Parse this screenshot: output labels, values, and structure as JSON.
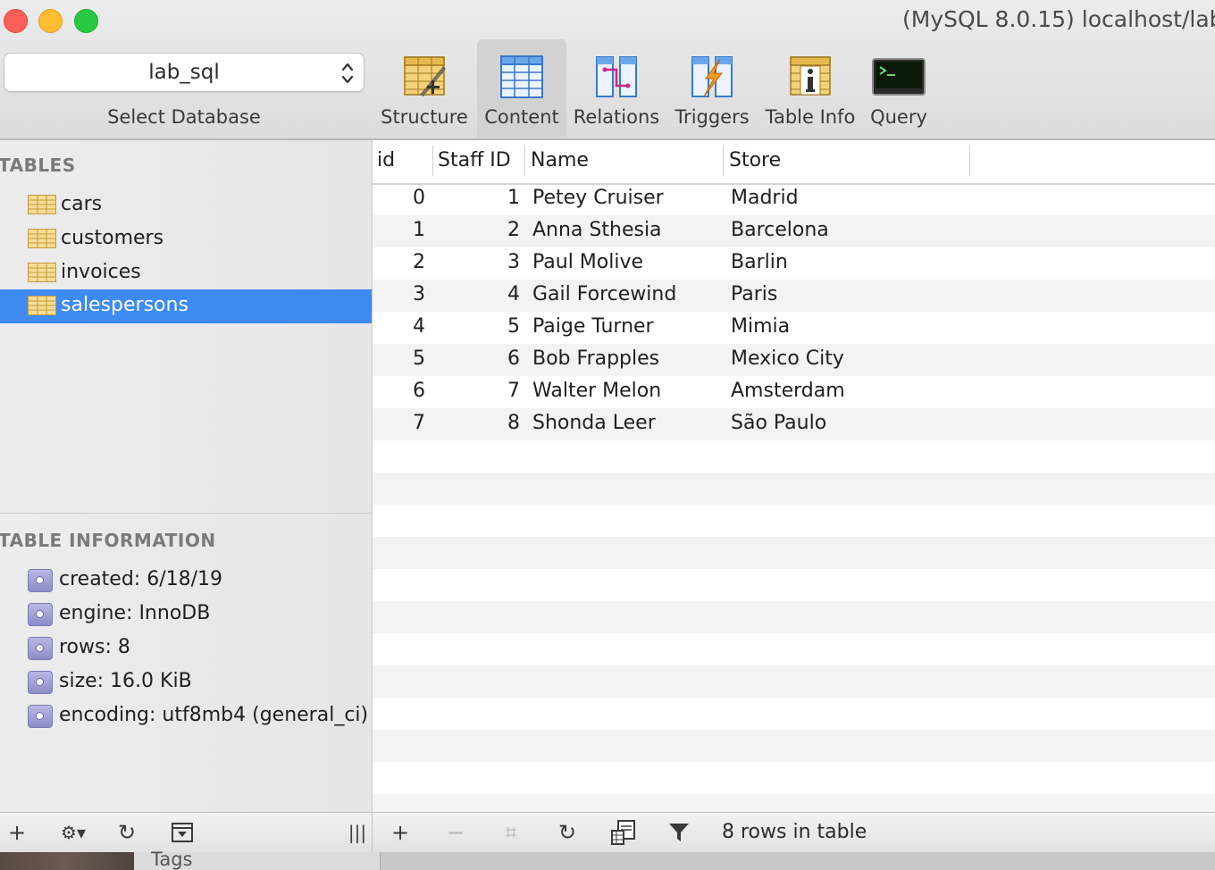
{
  "window": {
    "title": "(MySQL 8.0.15) localhost/lab"
  },
  "database_select": {
    "value": "lab_sql",
    "label": "Select Database"
  },
  "toolbar": {
    "items": [
      {
        "label": "Structure",
        "icon": "structure-icon"
      },
      {
        "label": "Content",
        "icon": "content-icon",
        "active": true
      },
      {
        "label": "Relations",
        "icon": "relations-icon"
      },
      {
        "label": "Triggers",
        "icon": "triggers-icon"
      },
      {
        "label": "Table Info",
        "icon": "table-info-icon"
      },
      {
        "label": "Query",
        "icon": "terminal-icon"
      }
    ]
  },
  "sidebar": {
    "tables_header": "TABLES",
    "tables": [
      {
        "name": "cars"
      },
      {
        "name": "customers"
      },
      {
        "name": "invoices"
      },
      {
        "name": "salespersons",
        "selected": true
      }
    ],
    "info_header": "TABLE INFORMATION",
    "info": [
      {
        "text": "created: 6/18/19"
      },
      {
        "text": "engine: InnoDB"
      },
      {
        "text": "rows: 8"
      },
      {
        "text": "size: 16.0 KiB"
      },
      {
        "text": "encoding: utf8mb4 (general_ci)"
      }
    ]
  },
  "table": {
    "columns": [
      "id",
      "Staff ID",
      "Name",
      "Store"
    ],
    "rows": [
      [
        "0",
        "1",
        "Petey Cruiser",
        "Madrid"
      ],
      [
        "1",
        "2",
        "Anna Sthesia",
        "Barcelona"
      ],
      [
        "2",
        "3",
        "Paul Molive",
        "Barlin"
      ],
      [
        "3",
        "4",
        "Gail Forcewind",
        "Paris"
      ],
      [
        "4",
        "5",
        "Paige Turner",
        "Mimia"
      ],
      [
        "5",
        "6",
        "Bob Frapples",
        "Mexico City"
      ],
      [
        "6",
        "7",
        "Walter Melon",
        "Amsterdam"
      ],
      [
        "7",
        "8",
        "Shonda Leer",
        "São Paulo"
      ]
    ]
  },
  "bottom_left": {
    "add": "+",
    "gear": "⚙▾",
    "refresh": "↻",
    "columns": "|||"
  },
  "bottom_right": {
    "add": "+",
    "remove": "−",
    "duplicate": "⌗",
    "refresh": "↻",
    "status": "8 rows in table"
  },
  "background_tab": {
    "label": "Tags"
  },
  "colors": {
    "selection": "#3d8bf2",
    "close": "#fe5f57",
    "minimize": "#febc2e",
    "maximize": "#28c840"
  }
}
